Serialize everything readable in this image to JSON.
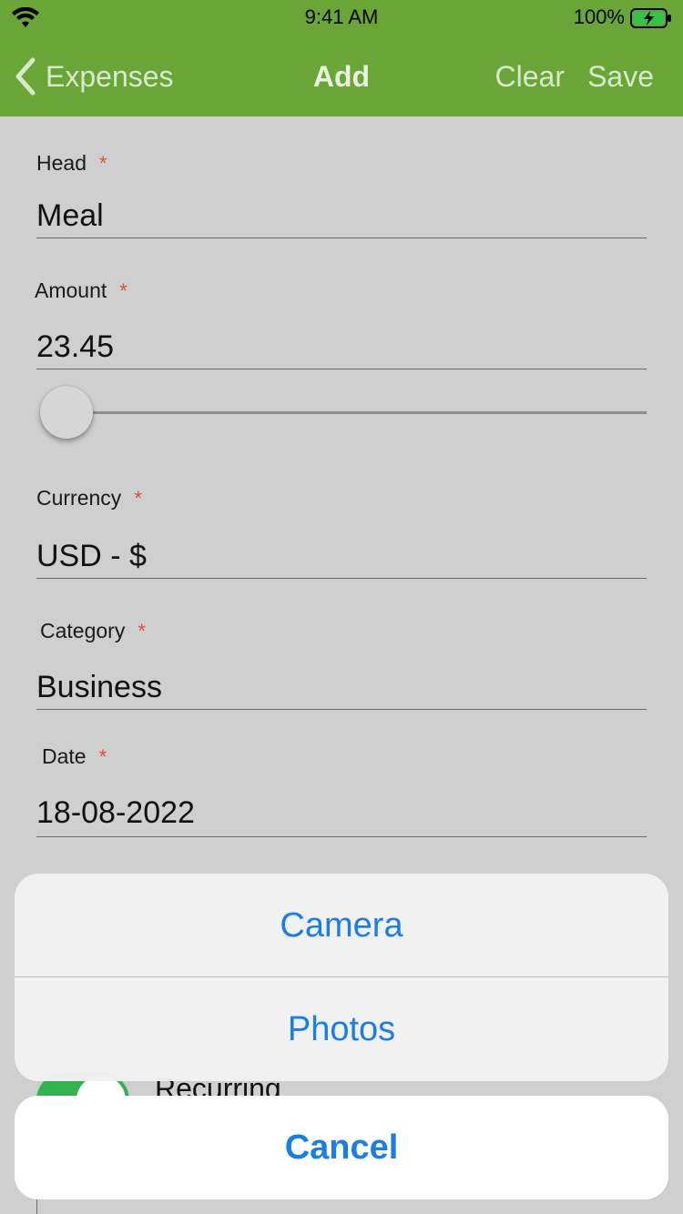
{
  "status_bar": {
    "time": "9:41 AM",
    "battery": "100%",
    "wifi_icon": "wifi-icon",
    "battery_icon": "battery-charging-icon"
  },
  "nav": {
    "back_label": "Expenses",
    "title": "Add",
    "clear_label": "Clear",
    "save_label": "Save",
    "back_icon": "chevron-left-icon",
    "bar_color": "#6aa637"
  },
  "form": {
    "required_marker": "*",
    "head": {
      "label": "Head",
      "value": "Meal"
    },
    "amount": {
      "label": "Amount",
      "value": "23.45",
      "slider_level": 0
    },
    "currency": {
      "label": "Currency",
      "value": "USD - $"
    },
    "category": {
      "label": "Category",
      "value": "Business"
    },
    "date": {
      "label": "Date",
      "value": "18-08-2022"
    },
    "recurring": {
      "label": "Recurring",
      "on": true,
      "toggle_color": "#34b24f"
    }
  },
  "action_sheet": {
    "options": [
      "Camera",
      "Photos"
    ],
    "cancel_label": "Cancel",
    "accent_color": "#1a7ee4"
  }
}
